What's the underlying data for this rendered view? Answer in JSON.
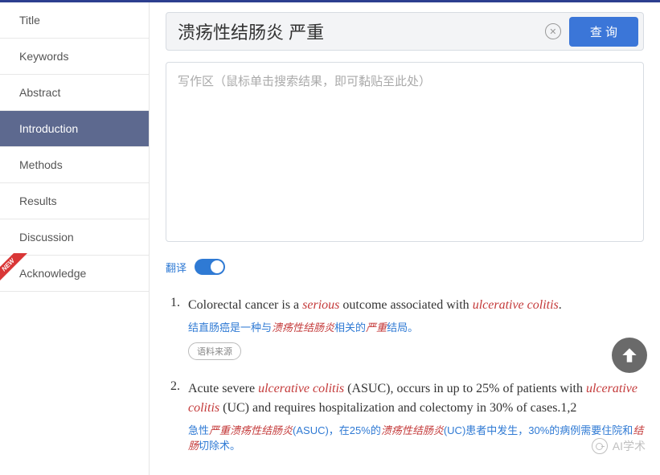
{
  "sidebar": {
    "items": [
      {
        "label": "Title"
      },
      {
        "label": "Keywords"
      },
      {
        "label": "Abstract"
      },
      {
        "label": "Introduction"
      },
      {
        "label": "Methods"
      },
      {
        "label": "Results"
      },
      {
        "label": "Discussion"
      },
      {
        "label": "Acknowledge"
      }
    ],
    "new_badge": "NEW"
  },
  "search": {
    "value": "溃疡性结肠炎 严重",
    "clear_symbol": "✕",
    "button_label": "查 询"
  },
  "writing_area": {
    "placeholder": "写作区（鼠标单击搜索结果，即可黏贴至此处）"
  },
  "translate": {
    "label": "翻译",
    "enabled": true
  },
  "results": [
    {
      "num": "1.",
      "parts": [
        {
          "t": "Colorectal cancer is a ",
          "hl": false
        },
        {
          "t": "serious",
          "hl": true
        },
        {
          "t": " outcome associated with ",
          "hl": false
        },
        {
          "t": "ulcerative colitis",
          "hl": true
        },
        {
          "t": ".",
          "hl": false
        }
      ],
      "zh_parts": [
        {
          "t": "结直肠癌是一种与",
          "hl": false
        },
        {
          "t": "溃疡性结肠炎",
          "hl": true
        },
        {
          "t": "相关的",
          "hl": false
        },
        {
          "t": "严重",
          "hl": true
        },
        {
          "t": "结局。",
          "hl": false
        }
      ],
      "source_label": "语料来源"
    },
    {
      "num": "2.",
      "parts": [
        {
          "t": "Acute severe ",
          "hl": false
        },
        {
          "t": "ulcerative colitis",
          "hl": true
        },
        {
          "t": " (ASUC), occurs in up to 25% of patients with ",
          "hl": false
        },
        {
          "t": "ulcerative colitis",
          "hl": true
        },
        {
          "t": " (UC) and requires hospitalization and colectomy in 30% of cases.1,2",
          "hl": false
        }
      ],
      "zh_parts": [
        {
          "t": "急性",
          "hl": false
        },
        {
          "t": "严重溃疡性结肠炎",
          "hl": true
        },
        {
          "t": "(ASUC)，在25%的",
          "hl": false
        },
        {
          "t": "溃疡性结肠炎",
          "hl": true
        },
        {
          "t": "(UC)患者中发生，30%的病例需要住院和",
          "hl": false
        },
        {
          "t": "结肠",
          "hl": true
        },
        {
          "t": "切除术。",
          "hl": false
        }
      ]
    }
  ],
  "watermark": {
    "text": "AI学术"
  }
}
